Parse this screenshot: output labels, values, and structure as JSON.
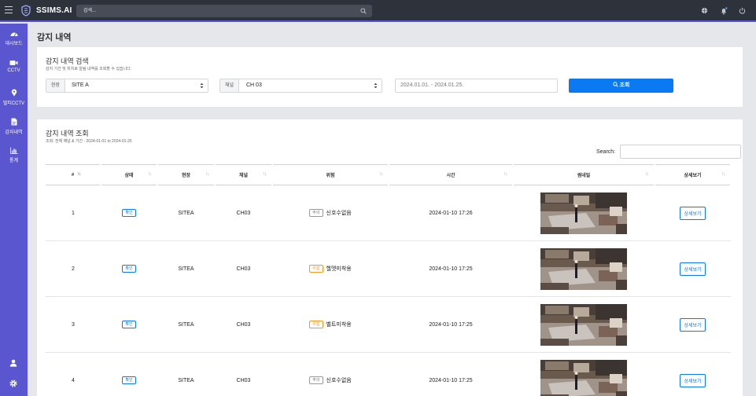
{
  "app": {
    "brand": "SSIMS.AI",
    "search_placeholder": "검색..."
  },
  "sidebar": {
    "items": [
      {
        "label": "대시보드",
        "icon": "dashboard-icon"
      },
      {
        "label": "CCTV",
        "icon": "video-camera-icon"
      },
      {
        "label": "멀티CCTV",
        "icon": "map-pin-icon"
      },
      {
        "label": "감지내역",
        "icon": "document-icon"
      },
      {
        "label": "통계",
        "icon": "bar-chart-icon"
      }
    ],
    "footer": [
      "user-icon",
      "gear-icon"
    ]
  },
  "page": {
    "title": "감지 내역"
  },
  "filter": {
    "title": "감지 내역 검색",
    "subtitle": "감지 기간 및 위치로 알림 내역를 조회할 수 있습니다.",
    "site_label": "현장",
    "site_value": "SITE A",
    "channel_label": "채널",
    "channel_value": "CH 03",
    "date_range": "2024.01.01. - 2024.01.25.",
    "button": "조회"
  },
  "results": {
    "title": "감지 내역 조회",
    "subtitle": "조회: 전체 채널 & 기간 - 2024-01-01 to 2024-01-25",
    "search_label": "Search:",
    "columns": [
      "#",
      "상태",
      "현장",
      "채널",
      "위험",
      "시간",
      "썸네일",
      "상세보기"
    ],
    "rows": [
      {
        "no": "1",
        "status": "확인",
        "site": "SITEA",
        "channel": "CH03",
        "risk_tag": "주의",
        "risk_level": "caution",
        "risk": "신호수없음",
        "time": "2024-01-10 17:26",
        "detail": "상세보기"
      },
      {
        "no": "2",
        "status": "확인",
        "site": "SITEA",
        "channel": "CH03",
        "risk_tag": "위험",
        "risk_level": "danger",
        "risk": "헬멧미착용",
        "time": "2024-01-10 17:25",
        "detail": "상세보기"
      },
      {
        "no": "3",
        "status": "확인",
        "site": "SITEA",
        "channel": "CH03",
        "risk_tag": "위험",
        "risk_level": "danger",
        "risk": "벨트미착용",
        "time": "2024-01-10 17:25",
        "detail": "상세보기"
      },
      {
        "no": "4",
        "status": "확인",
        "site": "SITEA",
        "channel": "CH03",
        "risk_tag": "주의",
        "risk_level": "caution",
        "risk": "신호수없음",
        "time": "2024-01-10 17:25",
        "detail": "상세보기"
      }
    ]
  },
  "colors": {
    "sidebar": "#5a56d0",
    "topbar": "#2d323b",
    "primary": "#0a79f2",
    "warning": "#f39a1e"
  }
}
